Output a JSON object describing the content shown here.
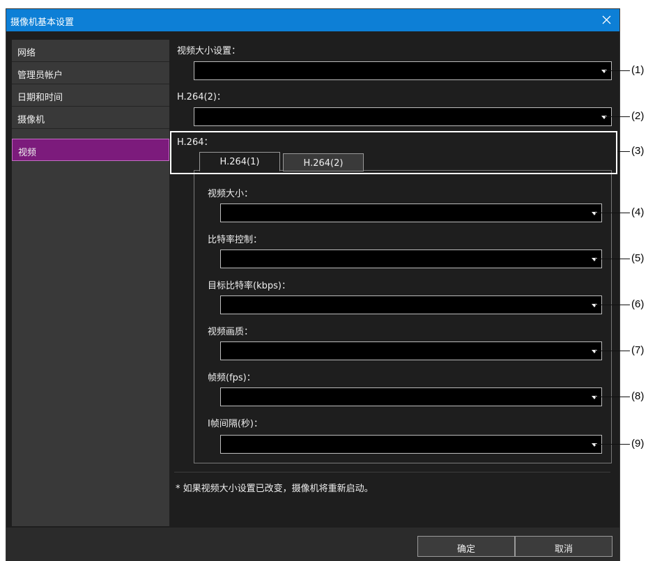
{
  "window": {
    "title": "摄像机基本设置"
  },
  "sidebar": {
    "items": [
      {
        "label": "网络"
      },
      {
        "label": "管理员帐户"
      },
      {
        "label": "日期和时间"
      },
      {
        "label": "摄像机"
      },
      {
        "label": "视频",
        "active": true
      }
    ]
  },
  "main": {
    "video_size_setting": {
      "label": "视频大小设置：",
      "value": ""
    },
    "h264_2_setting": {
      "label": "H.264(2)：",
      "value": ""
    },
    "h264_section": {
      "label": "H.264：",
      "tabs": [
        {
          "label": "H.264(1)",
          "selected": true
        },
        {
          "label": "H.264(2)",
          "selected": false
        }
      ]
    },
    "fields": [
      {
        "label": "视频大小：",
        "value": ""
      },
      {
        "label": "比特率控制：",
        "value": ""
      },
      {
        "label": "目标比特率(kbps)：",
        "value": ""
      },
      {
        "label": "视频画质：",
        "value": ""
      },
      {
        "label": "帧频(fps)：",
        "value": ""
      },
      {
        "label": "I帧间隔(秒)：",
        "value": ""
      }
    ],
    "note": "* 如果视频大小设置已改变，摄像机将重新启动。"
  },
  "footer": {
    "ok_label": "确定",
    "cancel_label": "取消"
  },
  "callouts": [
    "(1)",
    "(2)",
    "(3)",
    "(4)",
    "(5)",
    "(6)",
    "(7)",
    "(8)",
    "(9)"
  ],
  "colors": {
    "titlebar": "#0d7fd6",
    "active_nav": "#7c1b7c",
    "background": "#1e1e1e"
  }
}
